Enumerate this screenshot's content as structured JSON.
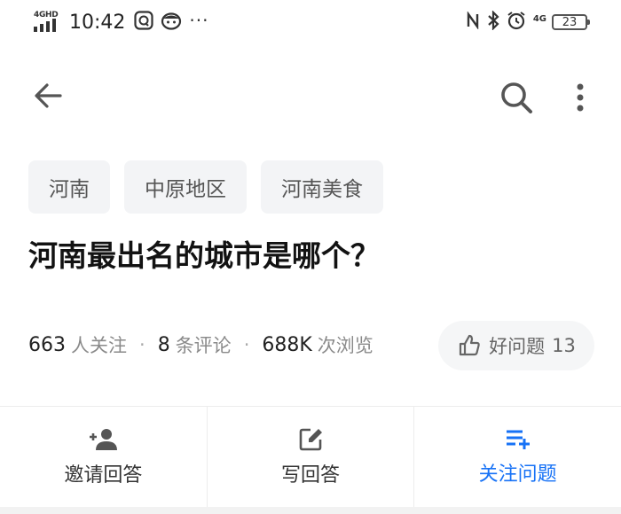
{
  "status_bar": {
    "network_left": "4GHD",
    "time": "10:42",
    "dots": "···",
    "network_right": "4G",
    "battery": "23"
  },
  "nav": {
    "back_icon": "arrow-left-icon",
    "search_icon": "search-icon",
    "more_icon": "more-vertical-icon"
  },
  "tags": [
    {
      "label": "河南"
    },
    {
      "label": "中原地区"
    },
    {
      "label": "河南美食"
    }
  ],
  "question": {
    "title": "河南最出名的城市是哪个？"
  },
  "stats": {
    "followers_count": "663",
    "followers_unit": "人关注",
    "separator": "·",
    "comments_count": "8",
    "comments_unit": "条评论",
    "views_count": "688K",
    "views_unit": "次浏览"
  },
  "good_question": {
    "label": "好问题",
    "count": "13"
  },
  "actions": {
    "invite": {
      "label": "邀请回答",
      "icon": "add-user-icon"
    },
    "answer": {
      "label": "写回答",
      "icon": "edit-icon"
    },
    "follow": {
      "label": "关注问题",
      "icon": "list-add-icon"
    }
  },
  "colors": {
    "accent": "#1772f6",
    "tag_bg": "#f3f4f6",
    "muted_text": "#8a8a8a"
  }
}
